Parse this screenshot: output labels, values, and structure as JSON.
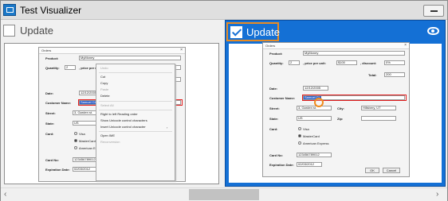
{
  "window": {
    "title": "Test Visualizer",
    "icons": {
      "app": "test-visualizer-icon",
      "minimize": "minimize-icon"
    }
  },
  "left": {
    "checkbox_label": "Update",
    "checked": false
  },
  "right": {
    "checkbox_label": "Update",
    "checked": true,
    "eye_icon": "eye-icon",
    "highlight_color": "#e98b22",
    "panel_color": "#1470d5"
  },
  "dialog": {
    "title": "Orders",
    "product_label": "Product:",
    "product_value": "MyMoney",
    "quantity_label": "Quantity:",
    "quantity_value": "2",
    "price_label": ", price per unit:",
    "price_value": "$100",
    "discount_label": ", discount:",
    "discount_value": "0%",
    "total_label": "Total:",
    "total_value": "200",
    "date_label": "Date:",
    "date_value": "12/12/2005",
    "customer_label": "Customer Name:",
    "customer_left": "Samuel Clemens",
    "customer_right": "Samuel Cl",
    "street_label": "Street:",
    "street_value": "3, Garden st.",
    "city_label": "City:",
    "city_value": "Hillsbery, UT",
    "state_label": "State:",
    "state_value": "US",
    "zip_label": "Zip:",
    "card_label": "Card:",
    "card_options": [
      "Visa",
      "MasterCard",
      "American Express"
    ],
    "cardno_label": "Card No:",
    "cardno_value": "123456789012",
    "exp_label": "Expiration Date:",
    "exp_value": "02/03/2012",
    "ok": "OK",
    "cancel": "Cancel"
  },
  "context_menu": [
    {
      "label": "Undo",
      "disabled": true
    },
    {
      "label": "Cut",
      "disabled": false
    },
    {
      "label": "Copy",
      "disabled": false
    },
    {
      "label": "Paste",
      "disabled": true
    },
    {
      "label": "Delete",
      "disabled": false
    },
    {
      "label": "Select All",
      "disabled": true
    },
    {
      "label": "Right to left Reading order",
      "disabled": false
    },
    {
      "label": "Show Unicode control characters",
      "disabled": false
    },
    {
      "label": "Insert Unicode control character",
      "disabled": false
    },
    {
      "label": "Open IME",
      "disabled": false
    },
    {
      "label": "Reconversion",
      "disabled": true
    }
  ],
  "scrollbar": {
    "left_arrow": "‹",
    "right_arrow": "›"
  }
}
